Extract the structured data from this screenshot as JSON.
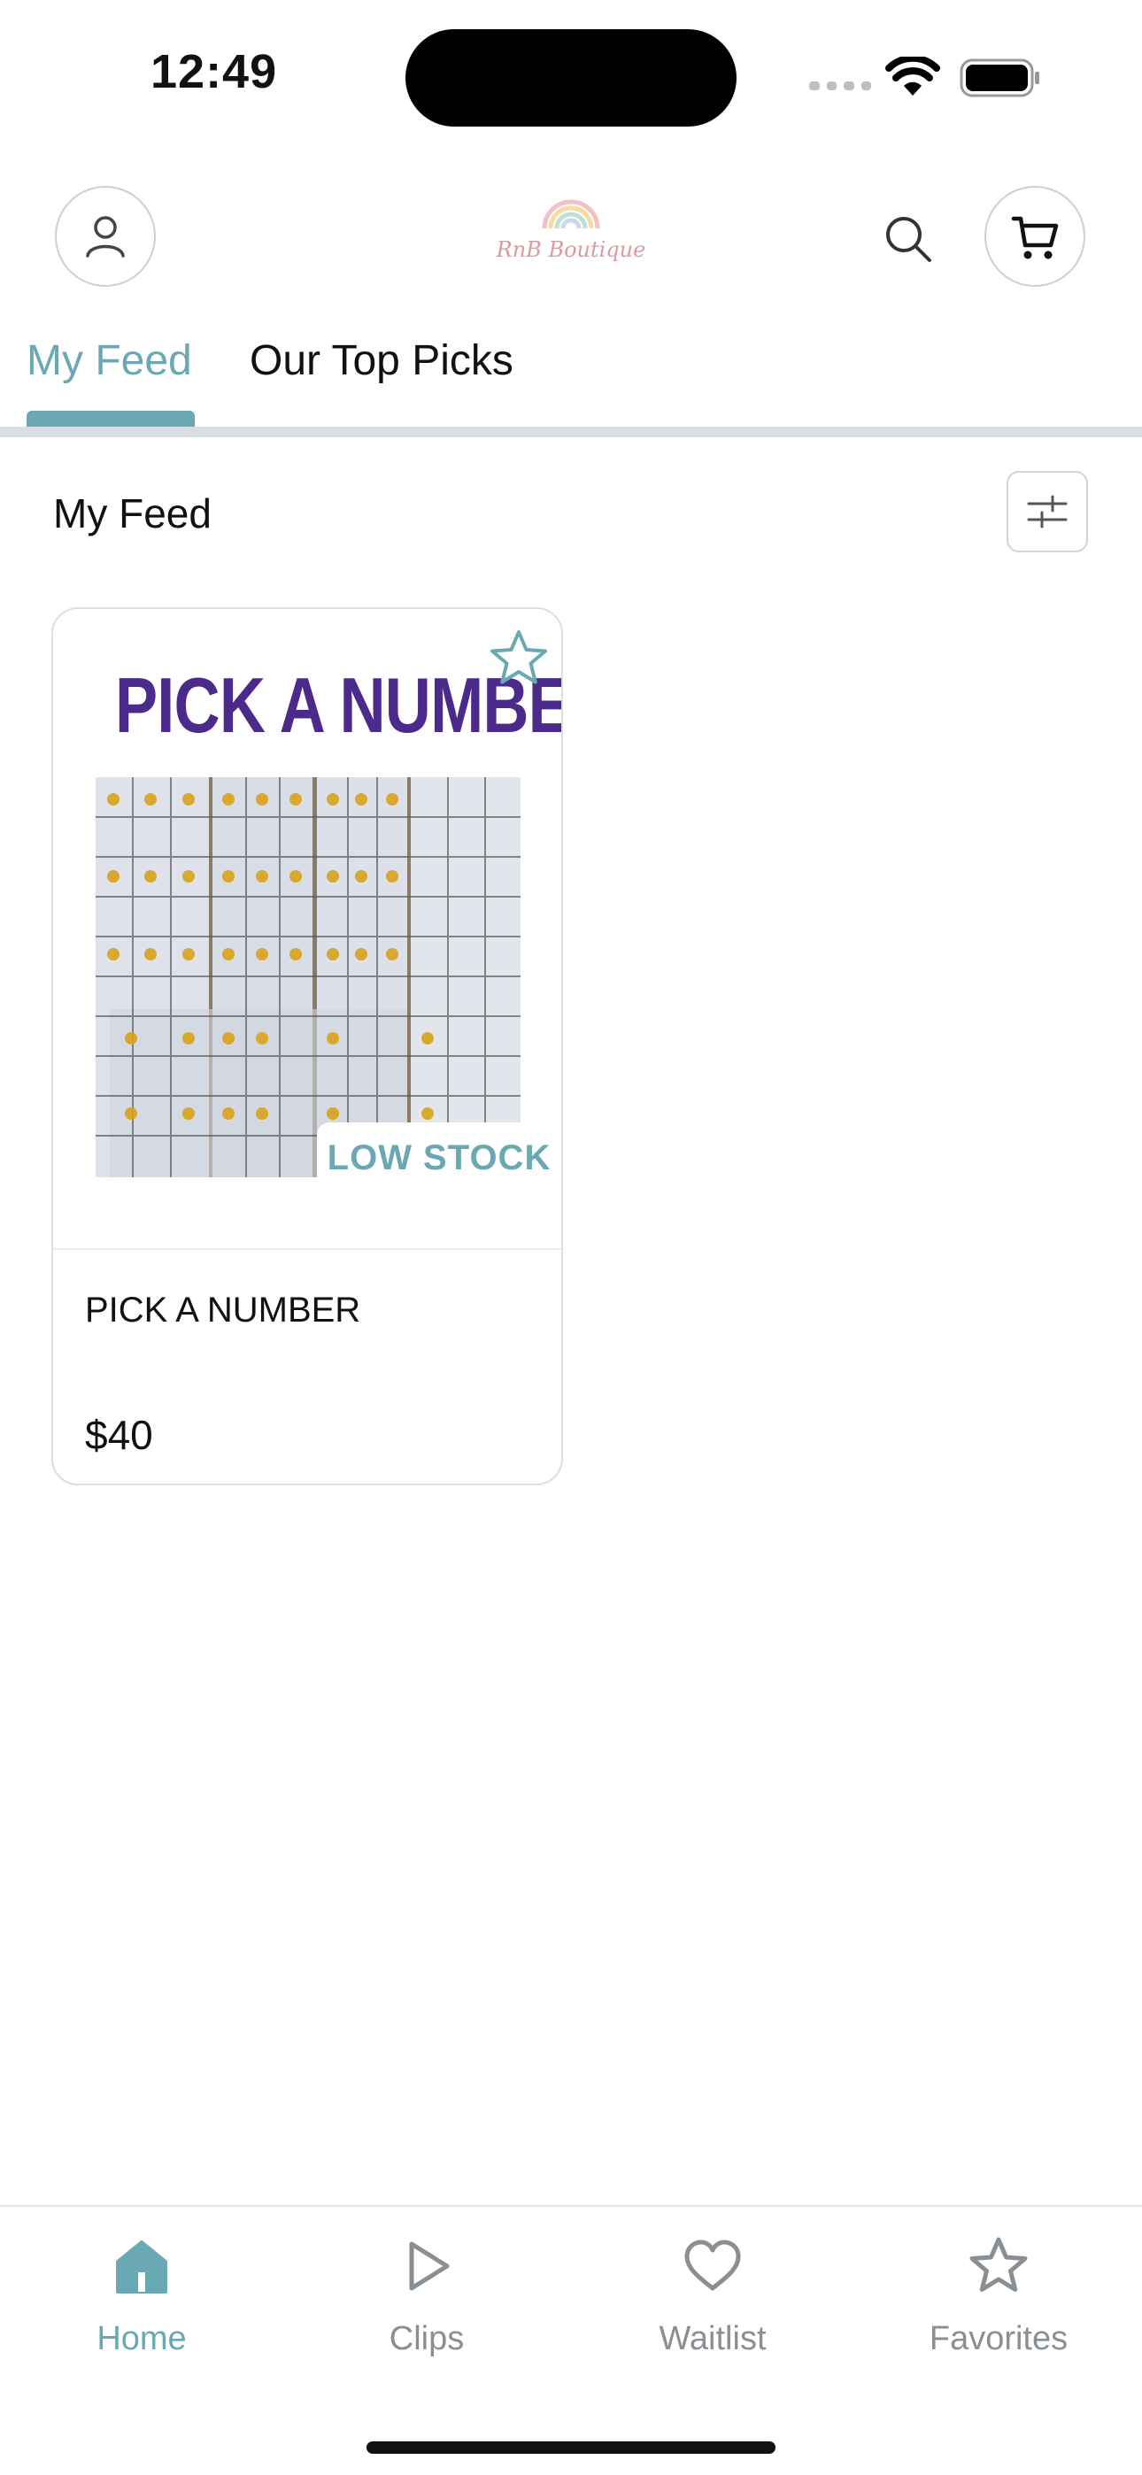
{
  "status_bar": {
    "time": "12:49"
  },
  "header": {
    "logo_text": "RnB Boutique",
    "icons": {
      "profile": "person-icon",
      "search": "search-icon",
      "cart": "cart-icon"
    }
  },
  "tabs": [
    {
      "label": "My Feed",
      "active": true
    },
    {
      "label": "Our Top Picks",
      "active": false
    }
  ],
  "section": {
    "title": "My Feed"
  },
  "products": [
    {
      "banner_text": "PICK A NUMBER",
      "badge": "LOW STOCK",
      "name": "PICK A NUMBER",
      "price": "$40",
      "favorited": false
    }
  ],
  "bottom_nav": [
    {
      "label": "Home",
      "icon": "home-icon",
      "active": true
    },
    {
      "label": "Clips",
      "icon": "play-icon",
      "active": false
    },
    {
      "label": "Waitlist",
      "icon": "heart-icon",
      "active": false
    },
    {
      "label": "Favorites",
      "icon": "star-icon",
      "active": false
    }
  ],
  "colors": {
    "accent": "#6aa9b4",
    "banner_purple": "#4b2a8c",
    "divider": "#d9dee2"
  }
}
